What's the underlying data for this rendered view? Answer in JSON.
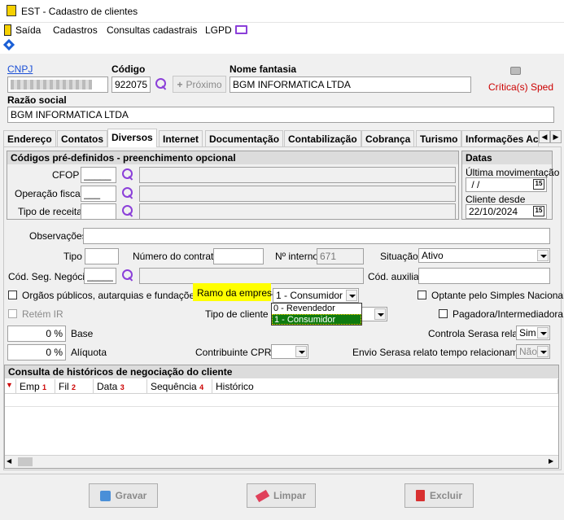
{
  "window": {
    "title": "EST - Cadastro de clientes"
  },
  "menu": [
    "Saída",
    "Cadastros",
    "Consultas cadastrais",
    "LGPD"
  ],
  "header": {
    "cnpj_label": "CNPJ",
    "cnpj_value": "",
    "codigo_label": "Código",
    "codigo_value": "922075",
    "proximo_label": "Próximo",
    "nome_fantasia_label": "Nome fantasia",
    "nome_fantasia_value": "BGM INFORMATICA LTDA",
    "critica_label": "Crítica(s) Sped",
    "razao_social_label": "Razão social",
    "razao_social_value": "BGM INFORMATICA LTDA"
  },
  "tabs": [
    "Endereço",
    "Contatos",
    "Diversos",
    "Internet",
    "Documentação",
    "Contabilização",
    "Cobrança",
    "Turismo",
    "Informações Ac"
  ],
  "codigos": {
    "title": "Códigos pré-definidos - preenchimento opcional",
    "cfop_label": "CFOP",
    "cfop_value": "_____",
    "operacao_label": "Operação fiscal",
    "operacao_value": "___",
    "receita_label": "Tipo de receita"
  },
  "datas": {
    "title": "Datas",
    "ultima_label": "Última movimentação",
    "ultima_value": " / /",
    "cliente_label": "Cliente desde",
    "cliente_value": "22/10/2024",
    "cal_icon_text": "15"
  },
  "form": {
    "observacoes_label": "Observações",
    "tipo_label": "Tipo",
    "contrato_label": "Número do contrato",
    "interno_label": "Nº interno",
    "interno_value": "671",
    "situacao_label": "Situação",
    "situacao_value": "Ativo",
    "seg_negocio_label": "Cód. Seg. Negócio",
    "seg_negocio_value": "_____",
    "cod_auxiliar_label": "Cód. auxiliar",
    "orgaos_label": "Orgãos públicos, autarquias e fundações",
    "ramo_label": "Ramo da empresa",
    "ramo_value": "1 - Consumidor",
    "ramo_options": [
      "0 - Revendedor",
      "1 - Consumidor"
    ],
    "optante_label": "Optante pelo Simples Nacional",
    "retem_label": "Retém IR",
    "tipo_cliente_label": "Tipo de cliente",
    "pagadora_label": "Pagadora/Intermediadora",
    "base_value": "0 %",
    "base_label": "Base",
    "serasa_label": "Controla Serasa relato",
    "serasa_value": "Sim",
    "aliquota_value": "0 %",
    "aliquota_label": "Alíquota",
    "cprb_label": "Contribuinte CPRB",
    "envio_label": "Envio Serasa relato tempo relacionamento",
    "envio_value": "Não"
  },
  "historico": {
    "title": "Consulta de históricos de negociação do cliente",
    "columns": [
      {
        "label": "Emp",
        "num": "1"
      },
      {
        "label": "Fil",
        "num": "2"
      },
      {
        "label": "Data",
        "num": "3"
      },
      {
        "label": "Sequência",
        "num": "4"
      },
      {
        "label": "Histórico",
        "num": ""
      }
    ]
  },
  "buttons": {
    "gravar": "Gravar",
    "limpar": "Limpar",
    "excluir": "Excluir"
  },
  "colors": {
    "accent": "#8b3fd9",
    "highlight": "#ffff00",
    "selection": "#0f7a0f",
    "critica": "#cc0000"
  }
}
